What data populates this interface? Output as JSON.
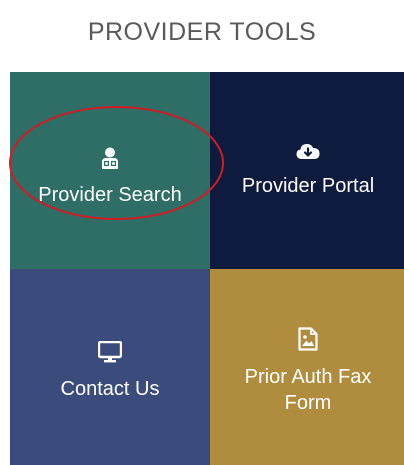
{
  "section": {
    "title": "PROVIDER TOOLS"
  },
  "tiles": [
    {
      "label": "Provider Search",
      "icon": "doctor-icon",
      "color": "#2f6d67"
    },
    {
      "label": "Provider Portal",
      "icon": "cloud-download-icon",
      "color": "#0f1a3f"
    },
    {
      "label": "Contact Us",
      "icon": "monitor-icon",
      "color": "#3a4b7c"
    },
    {
      "label": "Prior Auth Fax Form",
      "icon": "image-file-icon",
      "color": "#b08d3e"
    }
  ],
  "annotation": {
    "highlight_color": "#d41b22"
  }
}
